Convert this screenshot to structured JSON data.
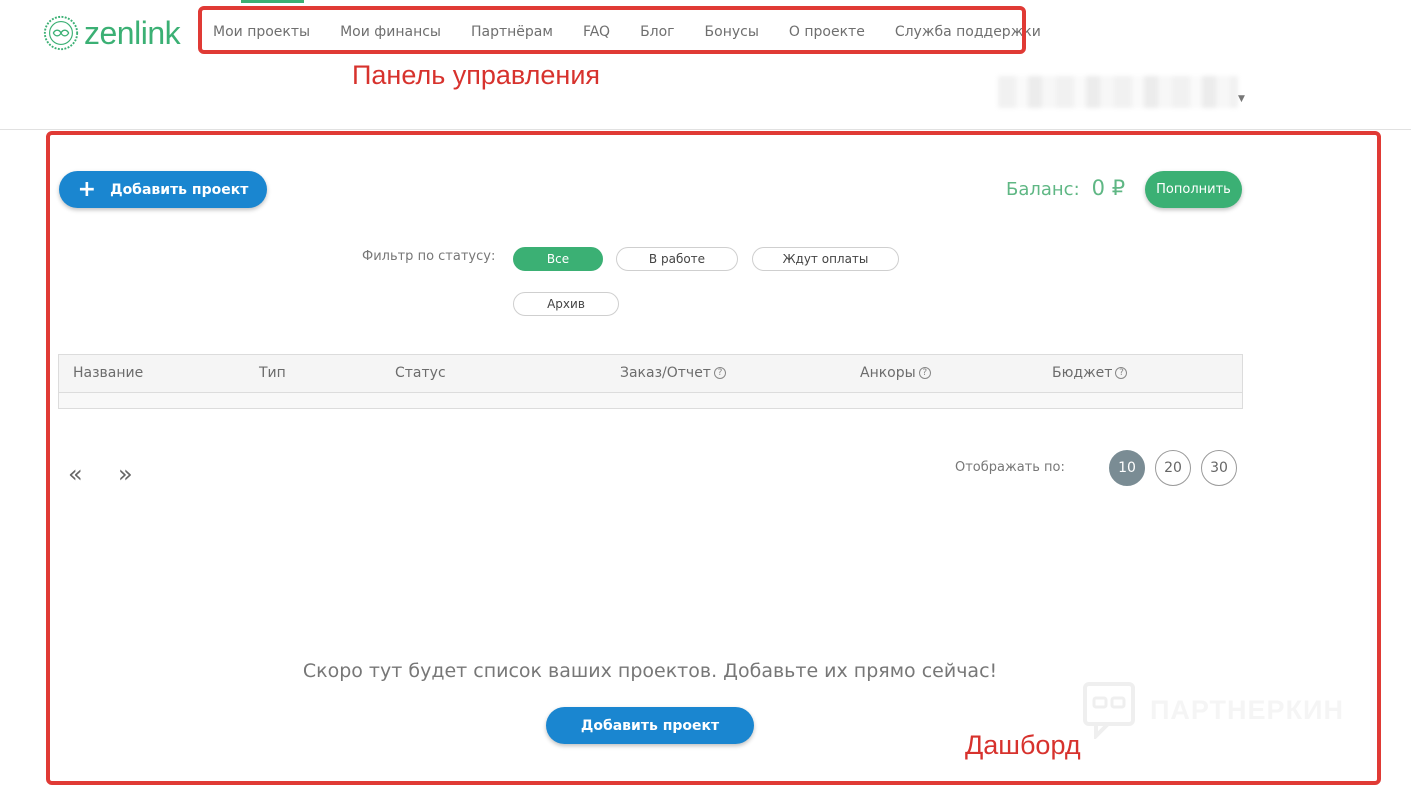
{
  "brand": {
    "name": "zenlink",
    "color": "#3bb074"
  },
  "nav": {
    "items": [
      {
        "label": "Мои проекты"
      },
      {
        "label": "Мои финансы"
      },
      {
        "label": "Партнёрам"
      },
      {
        "label": "FAQ"
      },
      {
        "label": "Блог"
      },
      {
        "label": "Бонусы"
      },
      {
        "label": "О проекте"
      },
      {
        "label": "Служба поддержки"
      }
    ]
  },
  "annotations": {
    "panel": "Панель управления",
    "dashboard": "Дашборд"
  },
  "toolbar": {
    "add_project_label": "Добавить проект",
    "balance_label": "Баланс:",
    "balance_amount": "0 ₽",
    "topup_label": "Пополнить"
  },
  "filter": {
    "label": "Фильтр по статусу:",
    "chips": [
      {
        "label": "Все",
        "active": true
      },
      {
        "label": "В работе"
      },
      {
        "label": "Ждут оплаты"
      },
      {
        "label": "Архив"
      }
    ]
  },
  "table": {
    "columns": [
      "Название",
      "Тип",
      "Статус",
      "Заказ/Отчет",
      "Анкоры",
      "Бюджет"
    ],
    "help_icon": "?"
  },
  "pagination": {
    "prev": "«",
    "next": "»",
    "per_page_label": "Отображать по:",
    "per_page_options": [
      "10",
      "20",
      "30"
    ],
    "selected": "10"
  },
  "empty_state": {
    "message": "Скоро тут будет список ваших проектов. Добавьте их прямо сейчас!",
    "add_label": "Добавить проект"
  },
  "watermark": {
    "text": "ПАРТНЕРКИН"
  },
  "colors": {
    "accent_blue": "#1a86d0",
    "accent_green": "#3bb074",
    "annotation_red": "#e03a35"
  }
}
